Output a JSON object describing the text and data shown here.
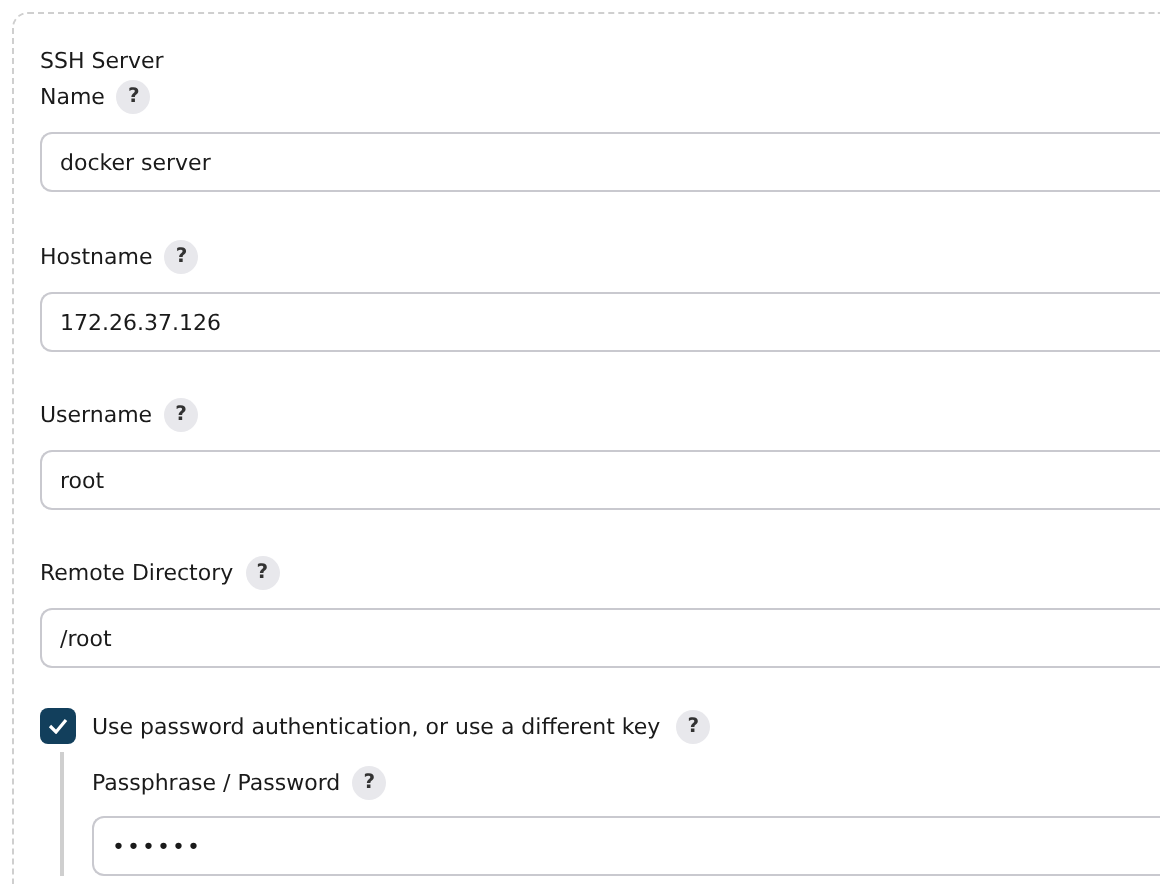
{
  "section": {
    "title": "SSH Server"
  },
  "fields": [
    {
      "label": "Name",
      "help": "?",
      "value": "docker server"
    },
    {
      "label": "Hostname",
      "help": "?",
      "value": "172.26.37.126"
    },
    {
      "label": "Username",
      "help": "?",
      "value": "root"
    },
    {
      "label": "Remote Directory",
      "help": "?",
      "value": "/root"
    }
  ],
  "password_option": {
    "label": "Use password authentication, or use a different key",
    "help": "?",
    "checked": true,
    "field": {
      "label": "Passphrase / Password",
      "help": "?",
      "value": "••••••"
    }
  }
}
